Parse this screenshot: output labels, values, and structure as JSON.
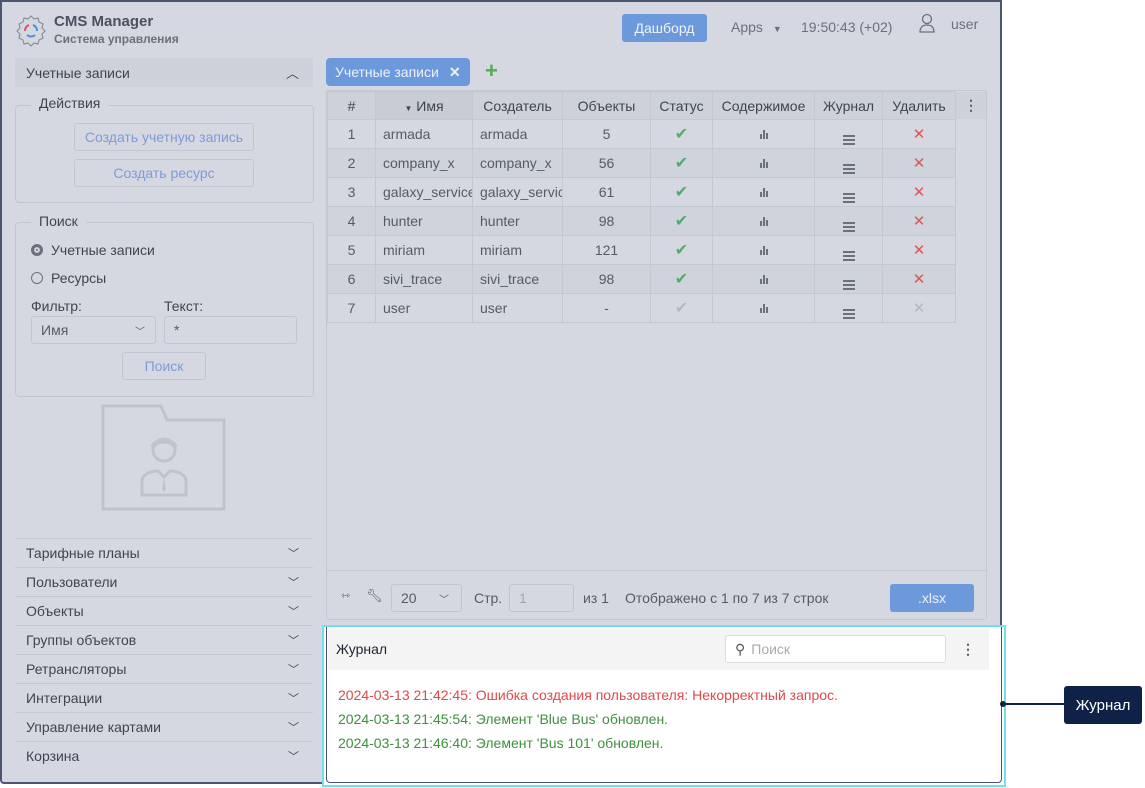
{
  "app": {
    "title": "CMS Manager",
    "subtitle": "Система управления"
  },
  "header": {
    "dashboard": "Дашборд",
    "apps": "Apps",
    "time": "19:50:43 (+02)",
    "user": "user"
  },
  "sidebar": {
    "section": "Учетные записи",
    "actions": {
      "legend": "Действия",
      "create_account": "Создать учетную запись",
      "create_resource": "Создать ресурс"
    },
    "search": {
      "legend": "Поиск",
      "radio_accounts": "Учетные записи",
      "radio_resources": "Ресурсы",
      "filter_label": "Фильтр:",
      "filter_value": "Имя",
      "text_label": "Текст:",
      "text_value": "*",
      "search_button": "Поиск"
    },
    "items": [
      {
        "label": "Тарифные планы"
      },
      {
        "label": "Пользователи"
      },
      {
        "label": "Объекты"
      },
      {
        "label": "Группы объектов"
      },
      {
        "label": "Ретрансляторы"
      },
      {
        "label": "Интеграции"
      },
      {
        "label": "Управление картами"
      },
      {
        "label": "Корзина"
      }
    ]
  },
  "tab": {
    "label": "Учетные записи"
  },
  "table": {
    "columns": [
      "#",
      "Имя",
      "Создатель",
      "Объекты",
      "Статус",
      "Содержимое",
      "Журнал",
      "Удалить"
    ],
    "rows": [
      {
        "n": "1",
        "name": "armada",
        "creator": "armada",
        "objects": "5",
        "active": true
      },
      {
        "n": "2",
        "name": "company_x",
        "creator": "company_x",
        "objects": "56",
        "active": true
      },
      {
        "n": "3",
        "name": "galaxy_service",
        "creator": "galaxy_service",
        "objects": "61",
        "active": true
      },
      {
        "n": "4",
        "name": "hunter",
        "creator": "hunter",
        "objects": "98",
        "active": true
      },
      {
        "n": "5",
        "name": "miriam",
        "creator": "miriam",
        "objects": "121",
        "active": true
      },
      {
        "n": "6",
        "name": "sivi_trace",
        "creator": "sivi_trace",
        "objects": "98",
        "active": true
      },
      {
        "n": "7",
        "name": "user",
        "creator": "user",
        "objects": "-",
        "active": false
      }
    ]
  },
  "pager": {
    "page_size": "20",
    "page_label": "Стр.",
    "page": "1",
    "of": "из 1",
    "summary": "Отображено с 1 по 7 из 7 строк",
    "export": ".xlsx"
  },
  "journal": {
    "title": "Журнал",
    "search_placeholder": "Поиск",
    "entries": [
      {
        "text": "2024-03-13 21:42:45: Ошибка создания пользователя: Некорректный запрос.",
        "type": "error"
      },
      {
        "text": "2024-03-13 21:45:54: Элемент 'Blue Bus' обновлен.",
        "type": "ok"
      },
      {
        "text": "2024-03-13 21:46:40: Элемент 'Bus 101' обновлен.",
        "type": "ok"
      }
    ]
  },
  "callout": {
    "label": "Журнал"
  },
  "colors": {
    "accent": "#6c98dc",
    "error": "#e04848",
    "ok": "#3f8f3f",
    "highlight": "#6ee0ef",
    "callout": "#0f2146"
  }
}
